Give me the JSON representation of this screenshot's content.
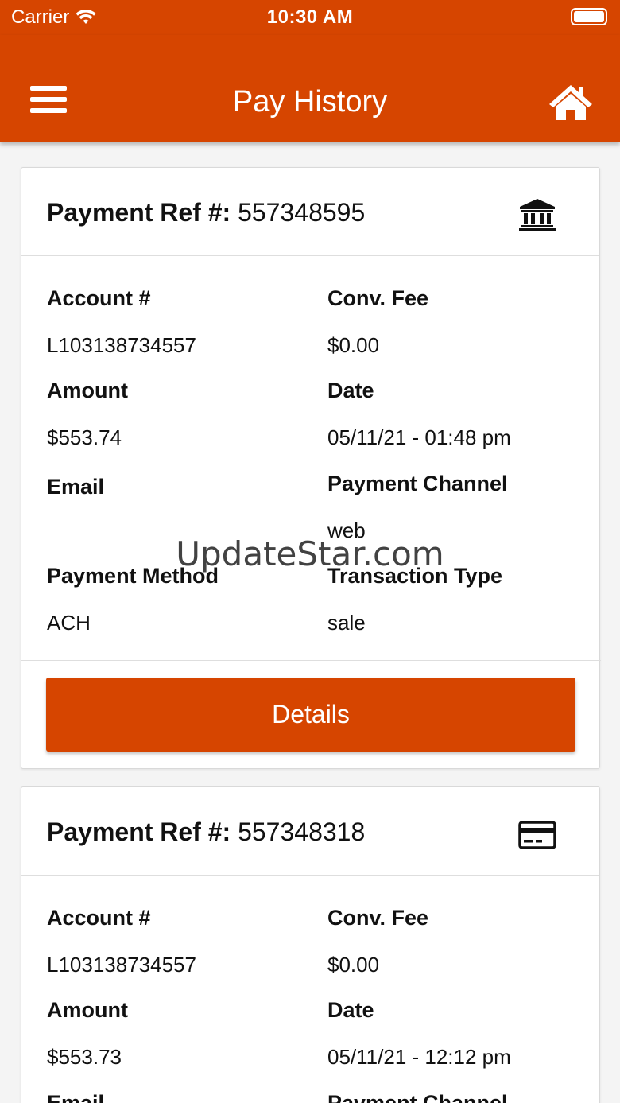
{
  "status_bar": {
    "carrier": "Carrier",
    "time": "10:30 AM"
  },
  "header": {
    "title": "Pay History",
    "menu_icon": "hamburger-menu-icon",
    "home_icon": "home-icon"
  },
  "labels": {
    "payment_ref": "Payment Ref #:",
    "account": "Account #",
    "conv_fee": "Conv. Fee",
    "amount": "Amount",
    "date": "Date",
    "email": "Email",
    "payment_channel": "Payment Channel",
    "payment_method": "Payment Method",
    "transaction_type": "Transaction Type",
    "details_button": "Details"
  },
  "payments": [
    {
      "ref": "557348595",
      "method_icon": "bank-icon",
      "account": "L103138734557",
      "conv_fee": "$0.00",
      "amount": "$553.74",
      "date": "05/11/21 - 01:48 pm",
      "email": "",
      "payment_channel": "web",
      "payment_method": "ACH",
      "transaction_type": "sale"
    },
    {
      "ref": "557348318",
      "method_icon": "credit-card-icon",
      "account": "L103138734557",
      "conv_fee": "$0.00",
      "amount": "$553.73",
      "date": "05/11/21 - 12:12 pm"
    }
  ],
  "watermark": "UpdateStar.com",
  "colors": {
    "brand": "#d64500",
    "background": "#f4f4f4"
  }
}
